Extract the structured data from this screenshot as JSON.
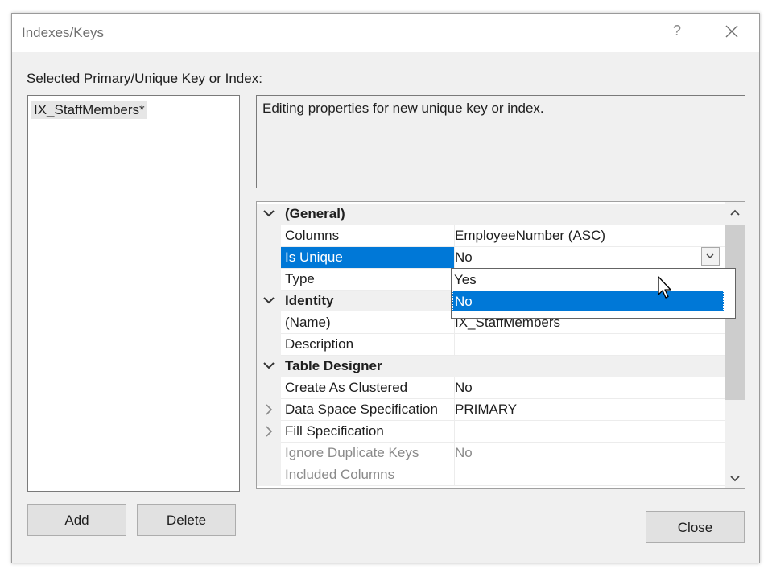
{
  "window": {
    "title": "Indexes/Keys",
    "help_glyph": "?"
  },
  "selected_label": "Selected Primary/Unique Key or Index:",
  "index_list": {
    "items": [
      "IX_StaffMembers*"
    ]
  },
  "description": "Editing properties for new unique key or index.",
  "properties": {
    "general": {
      "label": "(General)",
      "columns": {
        "name": "Columns",
        "value": "EmployeeNumber (ASC)"
      },
      "is_unique": {
        "name": "Is Unique",
        "value": "No"
      },
      "type": {
        "name": "Type",
        "value": ""
      }
    },
    "identity": {
      "label": "Identity",
      "name": {
        "name": "(Name)",
        "value": "IX_StaffMembers"
      },
      "description": {
        "name": "Description",
        "value": ""
      }
    },
    "table_designer": {
      "label": "Table Designer",
      "create_as_clustered": {
        "name": "Create As Clustered",
        "value": "No"
      },
      "data_space": {
        "name": "Data Space Specification",
        "value": "PRIMARY"
      },
      "fill_spec": {
        "name": "Fill Specification",
        "value": ""
      },
      "ignore_dup": {
        "name": "Ignore Duplicate Keys",
        "value": "No"
      },
      "included_columns": {
        "name": "Included Columns",
        "value": ""
      }
    }
  },
  "dropdown": {
    "options": [
      "Yes",
      "No"
    ],
    "selected": "No"
  },
  "buttons": {
    "add": "Add",
    "delete": "Delete",
    "close": "Close"
  },
  "colors": {
    "selection": "#0078d7",
    "dialog_bg": "#f0f0f0"
  }
}
